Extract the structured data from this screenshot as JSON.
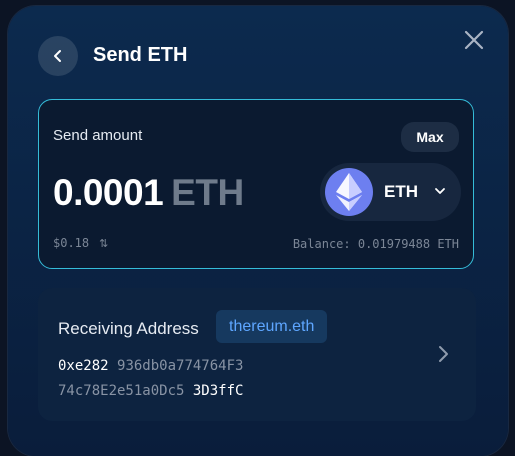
{
  "header": {
    "title": "Send ETH"
  },
  "amount_card": {
    "label": "Send amount",
    "max_label": "Max",
    "amount": "0.0001",
    "unit": "ETH",
    "usd_value": "$0.18",
    "swap_glyph": "⇅",
    "balance": "Balance: 0.01979488 ETH",
    "token": {
      "symbol": "ETH",
      "icon": "ethereum-icon",
      "color": "#6d7ff0"
    }
  },
  "receiving": {
    "label": "Receiving Address",
    "ens": "thereum.eth",
    "address_line1": {
      "start": "0xe282",
      "middle": "936db0a774764F3"
    },
    "address_line2": {
      "middle": "74c78E2e51a0Dc5",
      "end": "3D3ffC"
    }
  },
  "colors": {
    "accent_border": "#35bcd8",
    "ens_text": "#5ea6ff",
    "muted_text": "#7b8696"
  }
}
